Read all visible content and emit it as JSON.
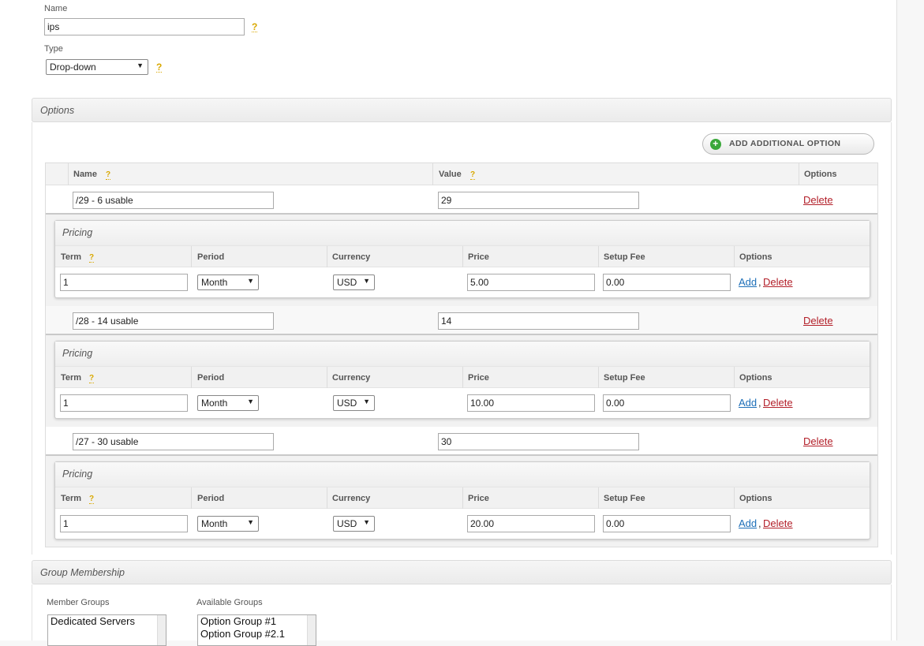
{
  "general": {
    "name_label": "Name",
    "name_value": "ips",
    "type_label": "Type",
    "type_value": "Drop-down",
    "help_mark": "?"
  },
  "options_section": {
    "title": "Options",
    "add_button_label": "ADD ADDITIONAL OPTION",
    "columns": {
      "name": "Name",
      "value": "Value",
      "options": "Options"
    },
    "delete_label": "Delete",
    "pricing": {
      "title": "Pricing",
      "columns": {
        "term": "Term",
        "period": "Period",
        "currency": "Currency",
        "price": "Price",
        "setup_fee": "Setup Fee",
        "options": "Options"
      },
      "add_label": "Add",
      "delete_label": "Delete",
      "separator": ","
    },
    "options": [
      {
        "name": "/29 - 6 usable",
        "value": "29",
        "term": "1",
        "period": "Month",
        "currency": "USD",
        "price": "5.00",
        "setup_fee": "0.00"
      },
      {
        "name": "/28 - 14 usable",
        "value": "14",
        "term": "1",
        "period": "Month",
        "currency": "USD",
        "price": "10.00",
        "setup_fee": "0.00"
      },
      {
        "name": "/27 - 30 usable",
        "value": "30",
        "term": "1",
        "period": "Month",
        "currency": "USD",
        "price": "20.00",
        "setup_fee": "0.00"
      }
    ]
  },
  "group_membership": {
    "title": "Group Membership",
    "member_groups_label": "Member Groups",
    "member_groups": [
      "Dedicated Servers"
    ],
    "available_groups_label": "Available Groups",
    "available_groups": [
      "Option Group #1",
      "Option Group #2.1"
    ]
  },
  "colors": {
    "help": "#d9a800",
    "delete_link": "#b3202a",
    "add_link": "#1d6fb8",
    "add_icon": "#3aa83a"
  }
}
